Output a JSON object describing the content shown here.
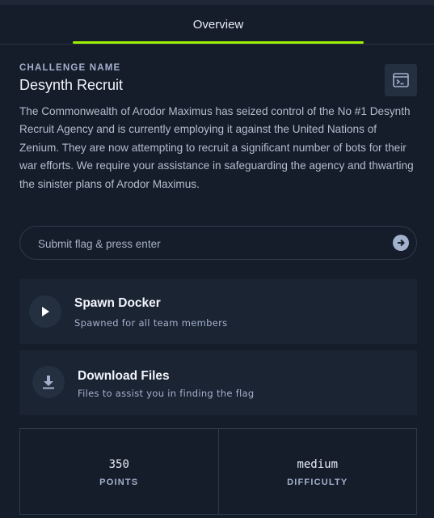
{
  "tabs": [
    {
      "label": "Overview",
      "active": true
    }
  ],
  "challenge": {
    "section_label": "CHALLENGE NAME",
    "name": "Desynth Recruit",
    "description": "The Commonwealth of Arodor Maximus has seized control of the No #1 Desynth Recruit Agency and is currently employing it against the United Nations of Zenium. They are now attempting to recruit a significant number of bots for their war efforts. We require your assistance in safeguarding the agency and thwarting the sinister plans of Arodor Maximus."
  },
  "flag": {
    "placeholder": "Submit flag & press enter",
    "value": ""
  },
  "spawn": {
    "title": "Spawn Docker",
    "subtitle": "Spawned for all team members"
  },
  "download": {
    "title": "Download Files",
    "subtitle": "Files to assist you in finding the flag"
  },
  "stats": {
    "points": {
      "value": "350",
      "label": "POINTS"
    },
    "difficulty": {
      "value": "medium",
      "label": "DIFFICULTY"
    }
  },
  "colors": {
    "accent": "#9fef00",
    "background": "#151d2b",
    "card": "#1b2433",
    "muted": "#a4b1cd"
  }
}
